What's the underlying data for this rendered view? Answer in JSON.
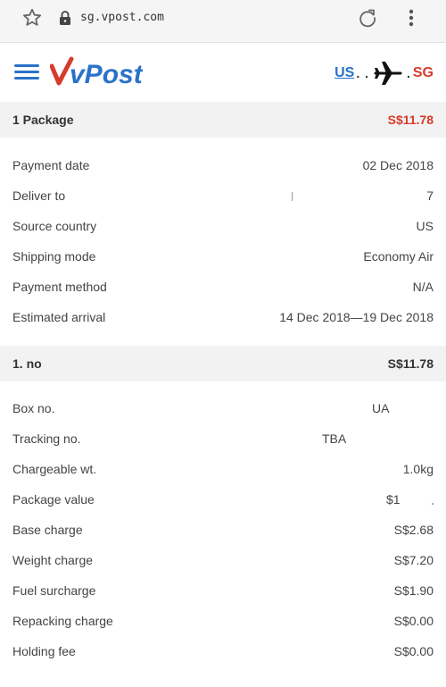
{
  "browser": {
    "url": "sg.vpost.com",
    "icons": [
      "star-icon",
      "lock-icon",
      "reload-icon",
      "more-vert-icon"
    ]
  },
  "header": {
    "logo_text": "vPost",
    "route": {
      "from": "US",
      "to": "SG"
    },
    "colors": {
      "accent": "#2a72c9",
      "destination": "#d63b2b"
    }
  },
  "package_summary": {
    "label": "1 Package",
    "total": "S$11.78",
    "total_color": "#d63b2b"
  },
  "details": [
    {
      "label": "Payment date",
      "value": "02 Dec 2018"
    },
    {
      "label": "Deliver to",
      "value": "7"
    },
    {
      "label": "Source country",
      "value": "US"
    },
    {
      "label": "Shipping mode",
      "value": "Economy Air"
    },
    {
      "label": "Payment method",
      "value": "N/A"
    },
    {
      "label": "Estimated arrival",
      "value": "14 Dec 2018—19 Dec 2018"
    }
  ],
  "item": {
    "label": "1. no",
    "total": "S$11.78",
    "rows": [
      {
        "label": "Box no.",
        "value": "UA"
      },
      {
        "label": "Tracking no.",
        "value": "TBA"
      },
      {
        "label": "Chargeable wt.",
        "value": "1.0kg"
      },
      {
        "label": "Package value",
        "value": "$1"
      },
      {
        "label": "Base charge",
        "value": "S$2.68"
      },
      {
        "label": "Weight charge",
        "value": "S$7.20"
      },
      {
        "label": "Fuel surcharge",
        "value": "S$1.90"
      },
      {
        "label": "Repacking charge",
        "value": "S$0.00"
      },
      {
        "label": "Holding fee",
        "value": "S$0.00"
      }
    ]
  }
}
